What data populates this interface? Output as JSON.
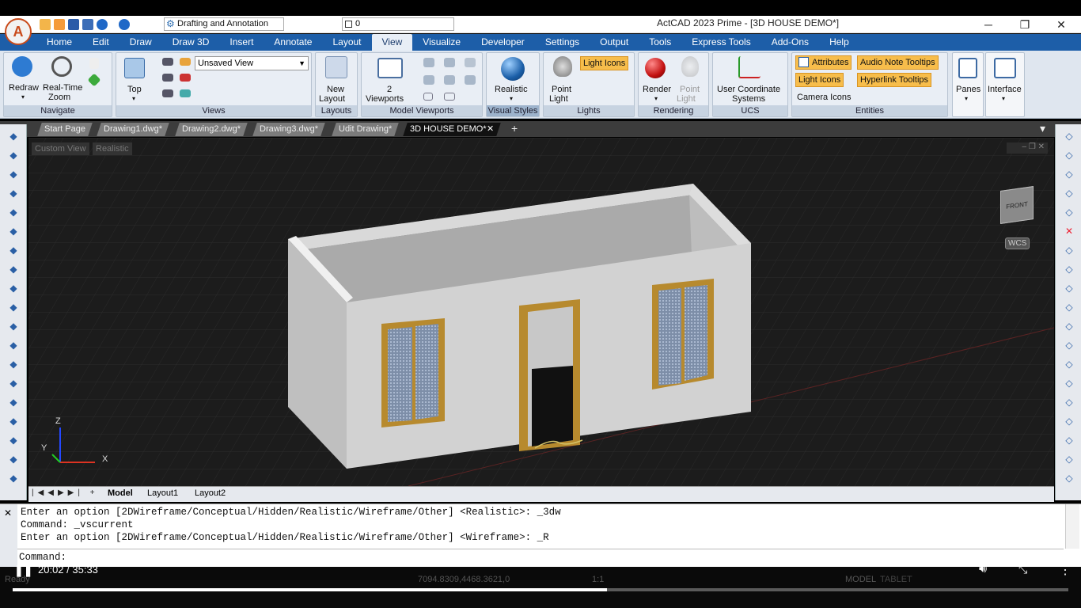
{
  "app": {
    "title": "ActCAD 2023 Prime - [3D HOUSE DEMO*]"
  },
  "qat": {
    "workspace": "Drafting and Annotation",
    "layer": "0"
  },
  "menu": [
    "Home",
    "Edit",
    "Draw",
    "Draw 3D",
    "Insert",
    "Annotate",
    "Layout",
    "View",
    "Visualize",
    "Developer",
    "Settings",
    "Output",
    "Tools",
    "Express Tools",
    "Add-Ons",
    "Help"
  ],
  "menu_active": "View",
  "ribbon": {
    "navigate": {
      "label": "Navigate",
      "redraw": "Redraw",
      "realtime": "Real-Time",
      "zoom": "Zoom"
    },
    "views": {
      "label": "Views",
      "top": "Top",
      "dropdown": "Unsaved View"
    },
    "layouts": {
      "label": "Layouts",
      "new": "New",
      "layout": "Layout"
    },
    "model_viewports": {
      "label": "Model Viewports",
      "count": "2",
      "viewports": "Viewports"
    },
    "visual_styles": {
      "label": "Visual Styles",
      "style": "Realistic"
    },
    "lights": {
      "label": "Lights",
      "point": "Point",
      "light": "Light",
      "light_icons": "Light Icons"
    },
    "rendering": {
      "label": "Rendering",
      "render": "Render",
      "point": "Point",
      "light": "Light"
    },
    "ucs": {
      "label": "UCS",
      "line1": "User Coordinate",
      "line2": "Systems"
    },
    "entities": {
      "label": "Entities",
      "attributes": "Attributes",
      "audio": "Audio Note Tooltips",
      "light_icons": "Light Icons",
      "hyperlink": "Hyperlink Tooltips",
      "camera": "Camera Icons"
    },
    "panes": "Panes",
    "interface": "Interface"
  },
  "tabs": [
    "Start Page",
    "Drawing1.dwg*",
    "Drawing2.dwg*",
    "Drawing3.dwg*",
    "Udit Drawing*",
    "3D HOUSE DEMO*"
  ],
  "viewport": {
    "view_label": "Custom View",
    "style_label": "Realistic",
    "viewcube": "FRONT",
    "wcs": "WCS",
    "axis_z": "Z",
    "axis_y": "Y",
    "axis_x": "X"
  },
  "layout_tabs": [
    "Model",
    "Layout1",
    "Layout2"
  ],
  "command": {
    "lines": [
      "Enter an option [2DWireframe/Conceptual/Hidden/Realistic/Wireframe/Other] <Realistic>: _3dw",
      "Command: _vscurrent",
      "Enter an option [2DWireframe/Conceptual/Hidden/Realistic/Wireframe/Other] <Wireframe>: _R"
    ],
    "prompt": "Command:"
  },
  "status": {
    "ready": "Ready",
    "coords": "7094.8309,4468.3621,0",
    "scale": "1:1",
    "model": "MODEL",
    "tablet": "TABLET"
  },
  "player": {
    "time": "20:02 / 35:33",
    "progress": 0.563
  }
}
